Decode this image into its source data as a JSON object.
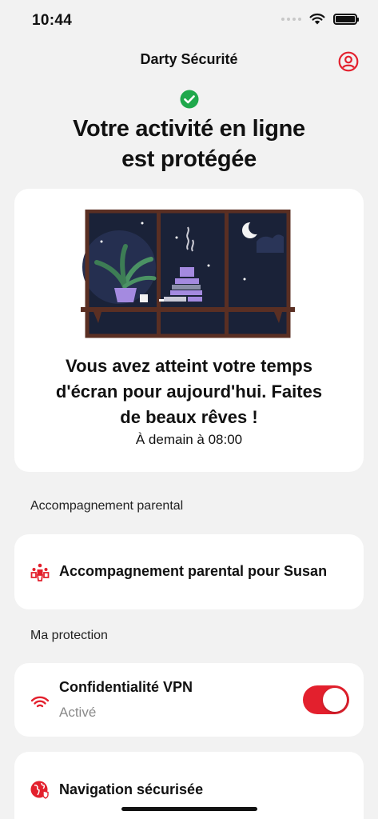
{
  "status_bar": {
    "time": "10:44"
  },
  "header": {
    "title": "Darty Sécurité"
  },
  "status": {
    "headline_line1": "Votre activité en ligne",
    "headline_line2": "est protégée"
  },
  "hero": {
    "message_line1": "Vous avez atteint votre temps",
    "message_line2": "d'écran pour aujourd'hui. Faites",
    "message_line3": "de beaux rêves !",
    "sub": "À demain à 08:00"
  },
  "sections": {
    "parental": {
      "label": "Accompagnement parental",
      "item_label": "Accompagnement parental pour Susan"
    },
    "protection": {
      "label": "Ma protection",
      "vpn": {
        "title": "Confidentialité VPN",
        "status": "Activé",
        "enabled": true
      },
      "safe_browsing": {
        "title": "Navigation sécurisée"
      }
    }
  },
  "colors": {
    "accent": "#e3202d",
    "success": "#1fa84b",
    "background": "#f2f2f2"
  }
}
